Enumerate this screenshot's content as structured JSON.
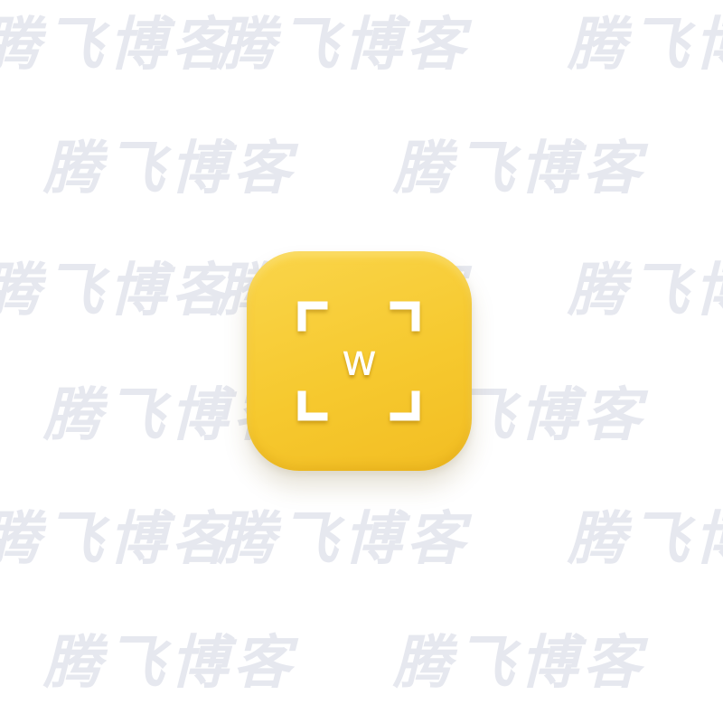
{
  "watermark": {
    "text": "腾飞博客",
    "color": "#e6e8ef"
  },
  "app_icon": {
    "letter": "w",
    "icon_name": "scan-frame-icon",
    "background_color": "#f6c92f",
    "symbol_color": "#ffffff"
  }
}
